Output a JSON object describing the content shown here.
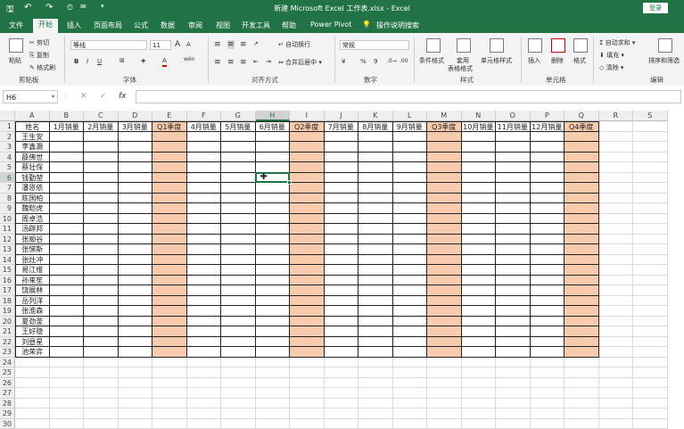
{
  "title_bar": {
    "title": "新建 Microsoft Excel 工作表.xlsx  -  Excel",
    "login": "登录",
    "save_icon": "save-icon",
    "undo_icon": "undo-icon",
    "redo_icon": "redo-icon"
  },
  "tabs": [
    "文件",
    "开始",
    "插入",
    "页面布局",
    "公式",
    "数据",
    "审阅",
    "视图",
    "开发工具",
    "帮助",
    "Power Pivot"
  ],
  "tell_me": "操作说明搜索",
  "ribbon": {
    "clipboard": {
      "label": "剪贴板",
      "paste": "粘贴",
      "cut": "剪切",
      "copy": "复制",
      "painter": "格式刷"
    },
    "font": {
      "label": "字体",
      "name": "等线",
      "size": "11",
      "increase": "A",
      "decrease": "A",
      "bold": "B",
      "italic": "I",
      "underline": "U",
      "font_color": "A",
      "wen": "wén"
    },
    "alignment": {
      "label": "对齐方式",
      "wrap": "自动换行",
      "merge": "合并后居中"
    },
    "number": {
      "label": "数字",
      "format": "常规",
      "percent": "%",
      "comma": "9"
    },
    "styles": {
      "label": "样式",
      "conditional": "条件格式",
      "table": "套用",
      "table2": "表格格式",
      "cell_styles": "单元格样式"
    },
    "cells": {
      "label": "单元格",
      "insert": "插入",
      "delete": "删除",
      "format": "格式"
    },
    "editing": {
      "label": "编辑",
      "autosum": "自动求和",
      "fill": "填充",
      "clear": "清除",
      "sort": "排序和筛选"
    }
  },
  "formula_bar": {
    "name_box": "H6",
    "fx": "fx",
    "cancel": "✕",
    "enter": "✓",
    "value": ""
  },
  "accent": "#217346",
  "quarter_fill": "#f8cbad",
  "columns": [
    "A",
    "B",
    "C",
    "D",
    "E",
    "F",
    "G",
    "H",
    "I",
    "J",
    "K",
    "L",
    "M",
    "N",
    "O",
    "P",
    "Q",
    "R",
    "S"
  ],
  "headers": [
    "姓名",
    "1月销量",
    "2月销量",
    "3月销量",
    "Q1季度",
    "4月销量",
    "5月销量",
    "6月销量",
    "Q2季度",
    "7月销量",
    "8月销量",
    "9月销量",
    "Q3季度",
    "10月销量",
    "11月销量",
    "12月销量",
    "Q4季度"
  ],
  "names": [
    "王生安",
    "李鑫灏",
    "薛佛世",
    "蔡壮保",
    "钱勤堃",
    "潘恩依",
    "陈国柏",
    "魏皑虎",
    "周卓浩",
    "汤辟邦",
    "张顺谷",
    "张悌斯",
    "张灶冲",
    "易江维",
    "孙来笙",
    "饶展林",
    "岳列洋",
    "张淮森",
    "夏劲釜",
    "王好隐",
    "刘昼星",
    "池荣弈"
  ],
  "row_count": 30,
  "selected_cell": "H6"
}
